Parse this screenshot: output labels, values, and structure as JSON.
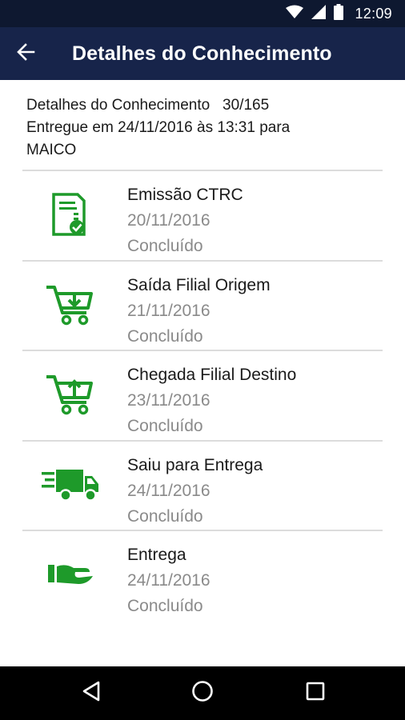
{
  "status_bar": {
    "time": "12:09"
  },
  "app_bar": {
    "title": "Detalhes do Conhecimento"
  },
  "summary": {
    "line1": "Detalhes do Conhecimento   30/165",
    "line2": "Entregue em 24/11/2016 às 13:31 para",
    "line3": "MAICO"
  },
  "steps": [
    {
      "name": "Emissão CTRC",
      "date": "20/11/2016",
      "status": "Concluído",
      "icon": "document-check-icon"
    },
    {
      "name": "Saída Filial Origem",
      "date": "21/11/2016",
      "status": "Concluído",
      "icon": "cart-down-icon"
    },
    {
      "name": "Chegada Filial Destino",
      "date": "23/11/2016",
      "status": "Concluído",
      "icon": "cart-up-icon"
    },
    {
      "name": "Saiu para Entrega",
      "date": "24/11/2016",
      "status": "Concluído",
      "icon": "delivery-truck-icon"
    },
    {
      "name": "Entrega",
      "date": "24/11/2016",
      "status": "Concluído",
      "icon": "hand-delivery-icon"
    }
  ],
  "colors": {
    "status_bar": "#0e1830",
    "app_bar": "#17244a",
    "icon_green": "#1e9a2a",
    "divider": "#dcdcdc"
  }
}
